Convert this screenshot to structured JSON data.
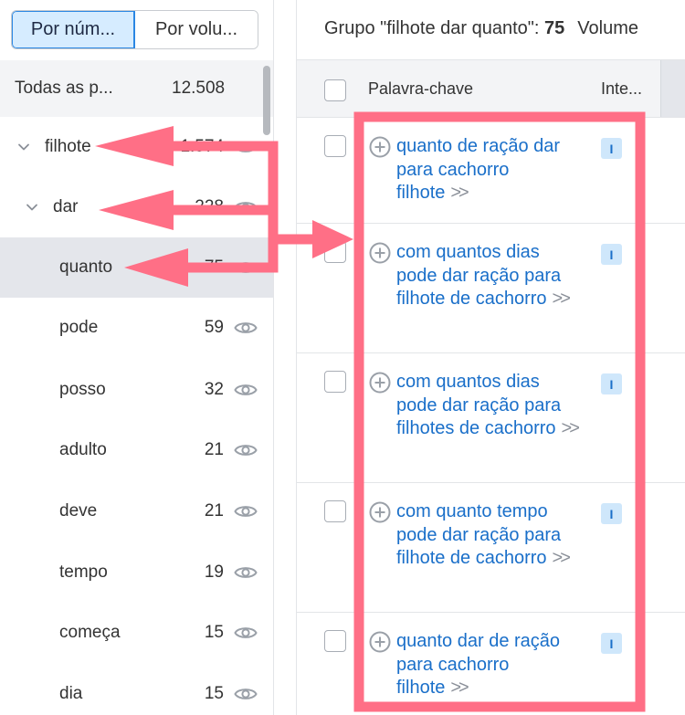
{
  "view_toggle": {
    "by_number": "Por núm...",
    "by_volume": "Por volu..."
  },
  "all_groups": {
    "label": "Todas as p...",
    "count": "12.508"
  },
  "tree": [
    {
      "keyword": "filhote",
      "count": "1.574",
      "level": 0,
      "expanded": true
    },
    {
      "keyword": "dar",
      "count": "228",
      "level": 1,
      "expanded": true
    },
    {
      "keyword": "quanto",
      "count": "75",
      "level": 2,
      "selected": true
    },
    {
      "keyword": "pode",
      "count": "59",
      "level": 2
    },
    {
      "keyword": "posso",
      "count": "32",
      "level": 2
    },
    {
      "keyword": "adulto",
      "count": "21",
      "level": 2
    },
    {
      "keyword": "deve",
      "count": "21",
      "level": 2
    },
    {
      "keyword": "tempo",
      "count": "19",
      "level": 2
    },
    {
      "keyword": "começa",
      "count": "15",
      "level": 2
    },
    {
      "keyword": "dia",
      "count": "15",
      "level": 2
    }
  ],
  "group_header": {
    "prefix": "Grupo \"filhote dar quanto\": ",
    "count": "75",
    "volume_label": "Volume"
  },
  "table_header": {
    "keyword": "Palavra-chave",
    "intent": "Inte..."
  },
  "rows": [
    {
      "keyword": "quanto de ração dar para cachorro filhote",
      "intent": "I"
    },
    {
      "keyword": "com quantos dias pode dar ração para filhote de cachorro",
      "intent": "I"
    },
    {
      "keyword": "com quantos dias pode dar ração para filhotes de cachorro",
      "intent": "I"
    },
    {
      "keyword": "com quanto tempo pode dar ração para filhote de cachorro",
      "intent": "I"
    },
    {
      "keyword": "quanto dar de ração para cachorro filhote",
      "intent": "I"
    }
  ],
  "colors": {
    "annotation": "#ff6f86",
    "link": "#1a6fc9",
    "badge_bg": "#cfe7fb",
    "selected_row": "#e4e6eb",
    "toggle_active": "#d6ecff"
  },
  "icons": {
    "expand": "chevron-down-icon",
    "visibility": "eye-icon",
    "add": "plus-circle-icon",
    "more": "double-chevron-right-icon"
  }
}
